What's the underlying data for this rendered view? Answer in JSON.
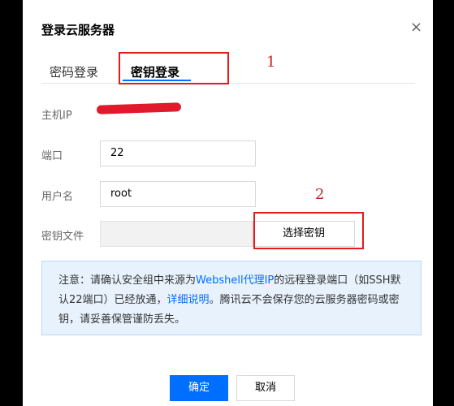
{
  "dialog": {
    "title": "登录云服务器",
    "close_icon": "close-icon",
    "close_glyph": "×"
  },
  "tabs": [
    {
      "label": "密码登录",
      "active": false
    },
    {
      "label": "密钥登录",
      "active": true
    }
  ],
  "annotations": {
    "num_1": "1",
    "num_2": "2",
    "color": "#e01c1c"
  },
  "form": {
    "host_ip_label": "主机IP",
    "host_ip_value": "",
    "port_label": "端口",
    "port_value": "22",
    "username_label": "用户名",
    "username_value": "root",
    "keyfile_label": "密钥文件",
    "keyfile_value": "",
    "select_key_button": "选择密钥"
  },
  "notice": {
    "prefix": "注意：请确认安全组中来源为",
    "link_1": "Webshell代理IP",
    "middle": "的远程登录端口（如SSH默认22端口）已经放通，",
    "link_2": "详细说明",
    "suffix": "。腾讯云不会保存您的云服务器密码或密钥，请妥善保管谨防丢失。"
  },
  "footer": {
    "confirm": "确定",
    "cancel": "取消"
  },
  "colors": {
    "accent": "#006eff",
    "notice_bg": "#e7f2fd",
    "annotation": "#e01c1c"
  }
}
